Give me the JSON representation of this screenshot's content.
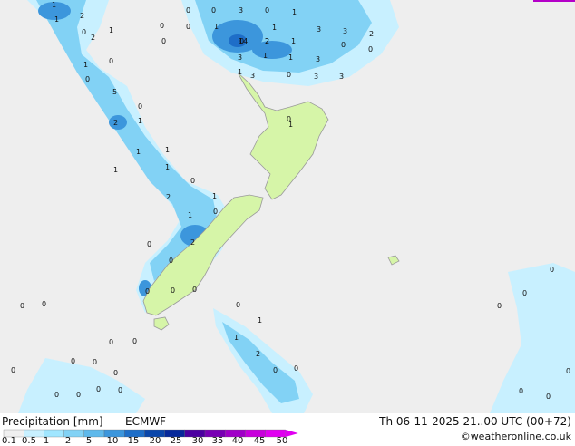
{
  "legend": {
    "title": "Precipitation [mm]",
    "model": "ECMWF",
    "valid_time": "Th 06-11-2025 21..00 UTC (00+72)",
    "credit": "©weatheronline.co.uk",
    "ticks": [
      "0.1",
      "0.5",
      "1",
      "2",
      "5",
      "10",
      "15",
      "20",
      "25",
      "30",
      "35",
      "40",
      "45",
      "50"
    ],
    "colors": [
      "#f0f0f0",
      "#c8f0ff",
      "#a0e6ff",
      "#82d2f5",
      "#5fb9eb",
      "#3c96dc",
      "#1e6ec8",
      "#0a46aa",
      "#06289a",
      "#4b00a0",
      "#7800b4",
      "#a000c8",
      "#c800dc",
      "#e000f0"
    ]
  },
  "map": {
    "background": "#eeeeee",
    "land": "#d6f5a8",
    "sea_labels": [
      {
        "v": "1"
      },
      {
        "v": "2"
      },
      {
        "v": "1"
      },
      {
        "v": "0"
      },
      {
        "v": "0"
      },
      {
        "v": "1"
      },
      {
        "v": "3"
      },
      {
        "v": "0"
      },
      {
        "v": "1"
      },
      {
        "v": "0"
      },
      {
        "v": "1"
      },
      {
        "v": "0"
      },
      {
        "v": "3"
      },
      {
        "v": "2"
      },
      {
        "v": "0"
      },
      {
        "v": "1"
      },
      {
        "v": "0"
      },
      {
        "v": "3"
      },
      {
        "v": "2"
      },
      {
        "v": "1"
      },
      {
        "v": "0"
      },
      {
        "v": "2"
      },
      {
        "v": "0"
      },
      {
        "v": "0"
      },
      {
        "v": "1"
      },
      {
        "v": "0"
      },
      {
        "v": "5"
      },
      {
        "v": "0"
      },
      {
        "v": "2"
      },
      {
        "v": "1"
      },
      {
        "v": "0"
      },
      {
        "v": "1"
      },
      {
        "v": "1"
      },
      {
        "v": "1"
      },
      {
        "v": "1"
      },
      {
        "v": "3"
      },
      {
        "v": "1"
      },
      {
        "v": "1"
      },
      {
        "v": "3"
      },
      {
        "v": "14"
      },
      {
        "v": "2"
      },
      {
        "v": "1"
      },
      {
        "v": "3"
      },
      {
        "v": "0"
      },
      {
        "v": "3"
      },
      {
        "v": "3"
      },
      {
        "v": "0"
      },
      {
        "v": "1"
      },
      {
        "v": "2"
      },
      {
        "v": "1"
      },
      {
        "v": "0"
      },
      {
        "v": "0"
      },
      {
        "v": "2"
      },
      {
        "v": "1"
      },
      {
        "v": "0"
      },
      {
        "v": "0"
      },
      {
        "v": "0"
      },
      {
        "v": "0"
      },
      {
        "v": "0"
      },
      {
        "v": "0"
      },
      {
        "v": "0"
      },
      {
        "v": "0"
      },
      {
        "v": "1"
      },
      {
        "v": "1"
      },
      {
        "v": "2"
      },
      {
        "v": "0"
      },
      {
        "v": "0"
      },
      {
        "v": "0"
      },
      {
        "v": "0"
      },
      {
        "v": "0"
      },
      {
        "v": "0"
      },
      {
        "v": "0"
      },
      {
        "v": "0"
      },
      {
        "v": "0"
      },
      {
        "v": "0"
      },
      {
        "v": "0"
      },
      {
        "v": "0"
      },
      {
        "v": "0"
      },
      {
        "v": "0"
      },
      {
        "v": "0"
      },
      {
        "v": "0"
      },
      {
        "v": "0"
      },
      {
        "v": "0"
      }
    ]
  }
}
